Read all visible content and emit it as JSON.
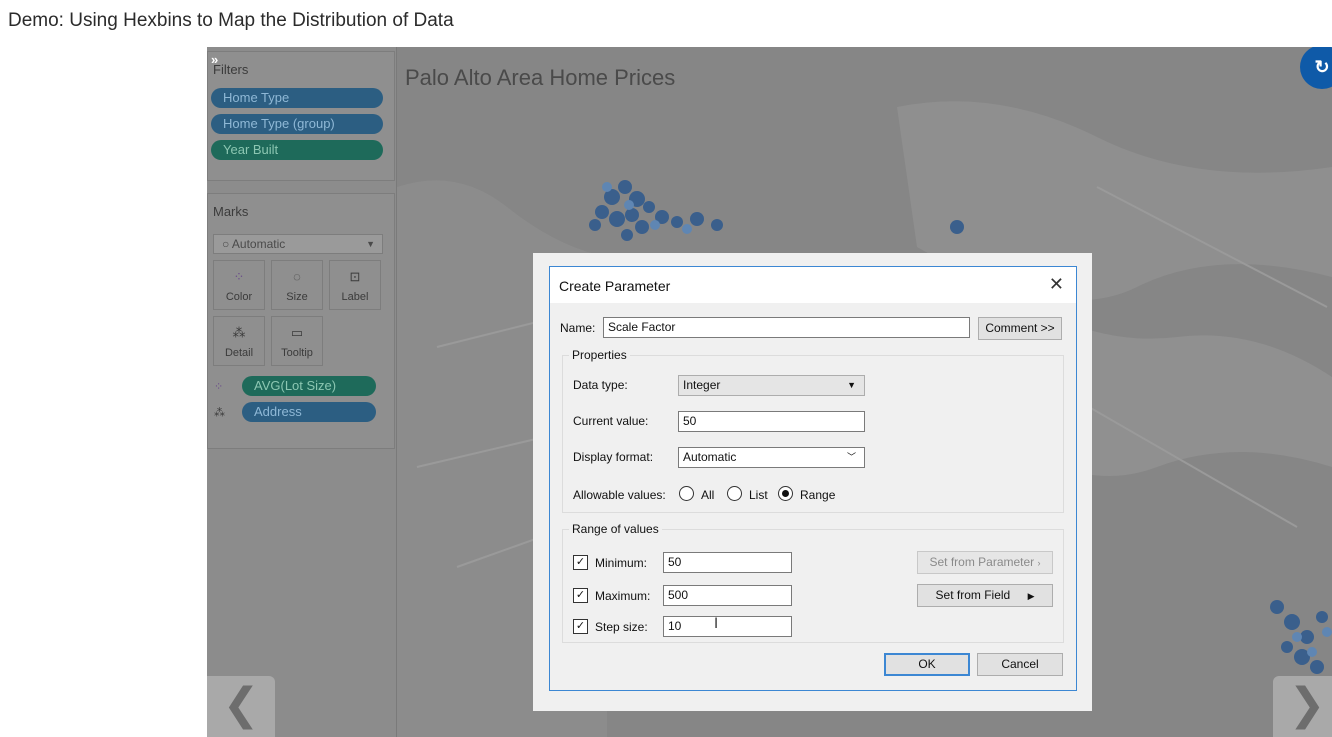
{
  "page": {
    "title": "Demo: Using Hexbins to Map the Distribution of Data"
  },
  "side_panel": {
    "expand_glyph": "»",
    "filters": {
      "title": "Filters",
      "pills": [
        "Home Type",
        "Home Type (group)",
        "Year Built"
      ]
    },
    "marks": {
      "title": "Marks",
      "mark_type": "Automatic",
      "buttons": {
        "color": "Color",
        "size": "Size",
        "label": "Label",
        "detail": "Detail",
        "tooltip": "Tooltip"
      },
      "fields": [
        "AVG(Lot Size)",
        "Address"
      ]
    }
  },
  "map": {
    "title": "Palo Alto Area Home Prices"
  },
  "dialog": {
    "title": "Create Parameter",
    "close_glyph": "✕",
    "name_label": "Name:",
    "name_value": "Scale Factor",
    "comment_button": "Comment >>",
    "properties": {
      "legend": "Properties",
      "data_type_label": "Data type:",
      "data_type_value": "Integer",
      "current_value_label": "Current value:",
      "current_value": "50",
      "display_format_label": "Display format:",
      "display_format_value": "Automatic",
      "allowable_label": "Allowable values:",
      "allowable_options": [
        "All",
        "List",
        "Range"
      ],
      "allowable_selected": "Range"
    },
    "range": {
      "legend": "Range of values",
      "minimum_label": "Minimum:",
      "minimum_value": "50",
      "maximum_label": "Maximum:",
      "maximum_value": "500",
      "step_label": "Step size:",
      "step_value": "10",
      "set_from_parameter": "Set from Parameter",
      "set_from_field": "Set from Field"
    },
    "ok_button": "OK",
    "cancel_button": "Cancel"
  },
  "nav": {
    "prev_glyph": "❮",
    "next_glyph": "❯"
  },
  "colors": {
    "accent": "#3c87d3",
    "pill_blue": "#2c5e82",
    "pill_green": "#1e6a5a",
    "refresh": "#0f5aa8"
  }
}
